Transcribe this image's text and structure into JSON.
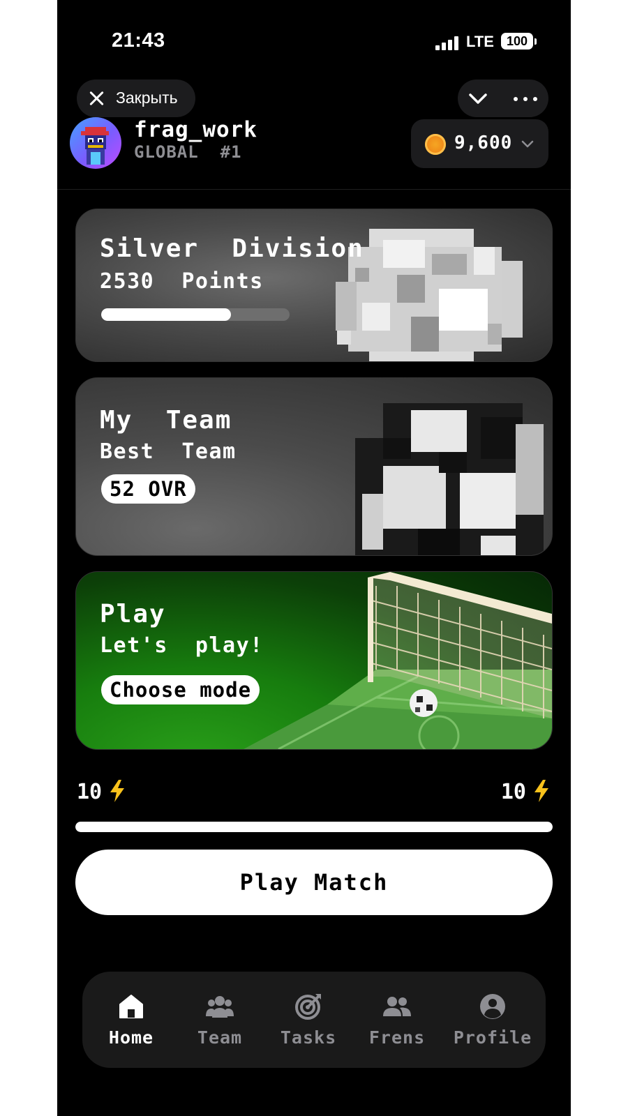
{
  "status_bar": {
    "time": "21:43",
    "network": "LTE",
    "battery": "100"
  },
  "header": {
    "close_label": "Закрыть",
    "username": "frag_work",
    "rank": "GLOBAL  #1",
    "coins": "9,600"
  },
  "cards": {
    "division": {
      "title": "Silver  Division",
      "subtitle": "2530  Points",
      "progress": 0.69
    },
    "team": {
      "title": "My  Team",
      "subtitle": "Best  Team",
      "badge": "52 OVR"
    },
    "play": {
      "title": "Play",
      "subtitle": "Let's  play!",
      "badge": "Choose mode"
    }
  },
  "energy": {
    "left": "10",
    "right": "10",
    "fill": 1.0
  },
  "play_button": "Play Match",
  "nav": {
    "items": [
      {
        "label": "Home",
        "icon": "home-icon",
        "active": true
      },
      {
        "label": "Team",
        "icon": "team-icon",
        "active": false
      },
      {
        "label": "Tasks",
        "icon": "tasks-icon",
        "active": false
      },
      {
        "label": "Frens",
        "icon": "frens-icon",
        "active": false
      },
      {
        "label": "Profile",
        "icon": "profile-icon",
        "active": false
      }
    ]
  },
  "colors": {
    "background": "#000000",
    "card_gray": "#4a4a4a",
    "card_green": "#177d0e",
    "nav_inactive": "#8e8e93",
    "accent_white": "#ffffff"
  }
}
